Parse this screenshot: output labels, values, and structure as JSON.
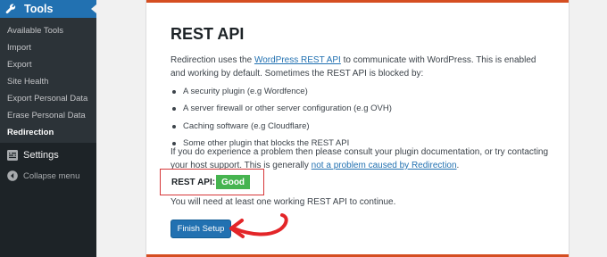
{
  "sidebar": {
    "active_menu": {
      "label": "Tools",
      "icon": "wrench-icon"
    },
    "submenu": [
      {
        "label": "Available Tools",
        "current": false
      },
      {
        "label": "Import",
        "current": false
      },
      {
        "label": "Export",
        "current": false
      },
      {
        "label": "Site Health",
        "current": false
      },
      {
        "label": "Export Personal Data",
        "current": false
      },
      {
        "label": "Erase Personal Data",
        "current": false
      },
      {
        "label": "Redirection",
        "current": true
      }
    ],
    "settings": {
      "label": "Settings",
      "icon": "settings-icon"
    },
    "collapse": {
      "label": "Collapse menu",
      "icon": "collapse-icon"
    }
  },
  "main": {
    "title": "REST API",
    "intro": {
      "before_link": "Redirection uses the ",
      "link": "WordPress REST API",
      "after_link": " to communicate with WordPress. This is enabled and working by default. Sometimes the REST API is blocked by:"
    },
    "bullets": [
      "A security plugin (e.g Wordfence)",
      "A server firewall or other server configuration (e.g OVH)",
      "Caching software (e.g Cloudflare)",
      "Some other plugin that blocks the REST API"
    ],
    "support": {
      "text": "If you do experience a problem then please consult your plugin documentation, or try contacting your host support. This is generally ",
      "link": "not a problem caused by Redirection",
      "end": "."
    },
    "status": {
      "label": "REST API:",
      "value": "Good",
      "color": "#46b450"
    },
    "note": "You will need at least one working REST API to continue.",
    "finish_button": "Finish Setup"
  },
  "colors": {
    "accent": "#2271b1",
    "sidebar_bg": "#1d2327",
    "card_border": "#d54e21",
    "highlight": "#d63638"
  }
}
